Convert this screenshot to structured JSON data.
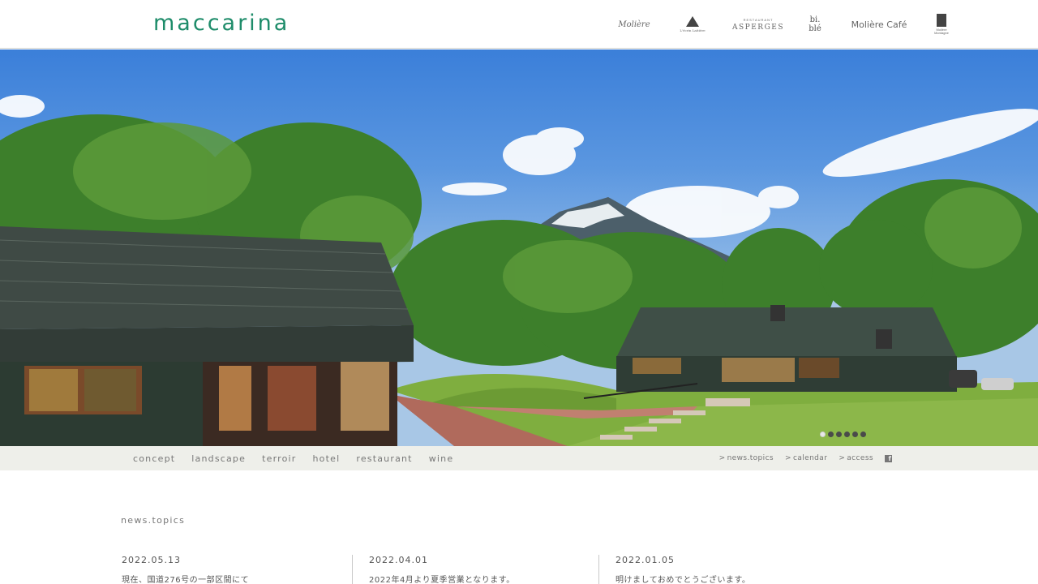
{
  "header": {
    "logo_text": "maccarina",
    "brands": {
      "moliere": "Molière",
      "lecrin_text": "L'écrin Laitière",
      "asperges_small": "RESTAURANT",
      "asperges_big": "ASPERGES",
      "bible_line1": "bi.",
      "bible_line2": "blé",
      "cafe": "Molière Café",
      "mountain_text": "Molière Montagne"
    }
  },
  "hero": {
    "slides": 6,
    "active_slide": 1
  },
  "nav": {
    "main": [
      "concept",
      "landscape",
      "terroir",
      "hotel",
      "restaurant",
      "wine"
    ],
    "sub": [
      {
        "arrow": ">",
        "label": "news.topics"
      },
      {
        "arrow": ">",
        "label": "calendar"
      },
      {
        "arrow": ">",
        "label": "access"
      }
    ],
    "facebook_icon": "f"
  },
  "news": {
    "heading": "news.topics",
    "items": [
      {
        "date": "2022.05.13",
        "title": "現在、国道276号の一部区間にて"
      },
      {
        "date": "2022.04.01",
        "title": "2022年4月より夏季営業となります。"
      },
      {
        "date": "2022.01.05",
        "title": "明けましておめでとうございます。"
      }
    ]
  },
  "colors": {
    "logo_green": "#1e8c6a",
    "navbar_bg": "#eeefea",
    "text_gray": "#777777"
  }
}
